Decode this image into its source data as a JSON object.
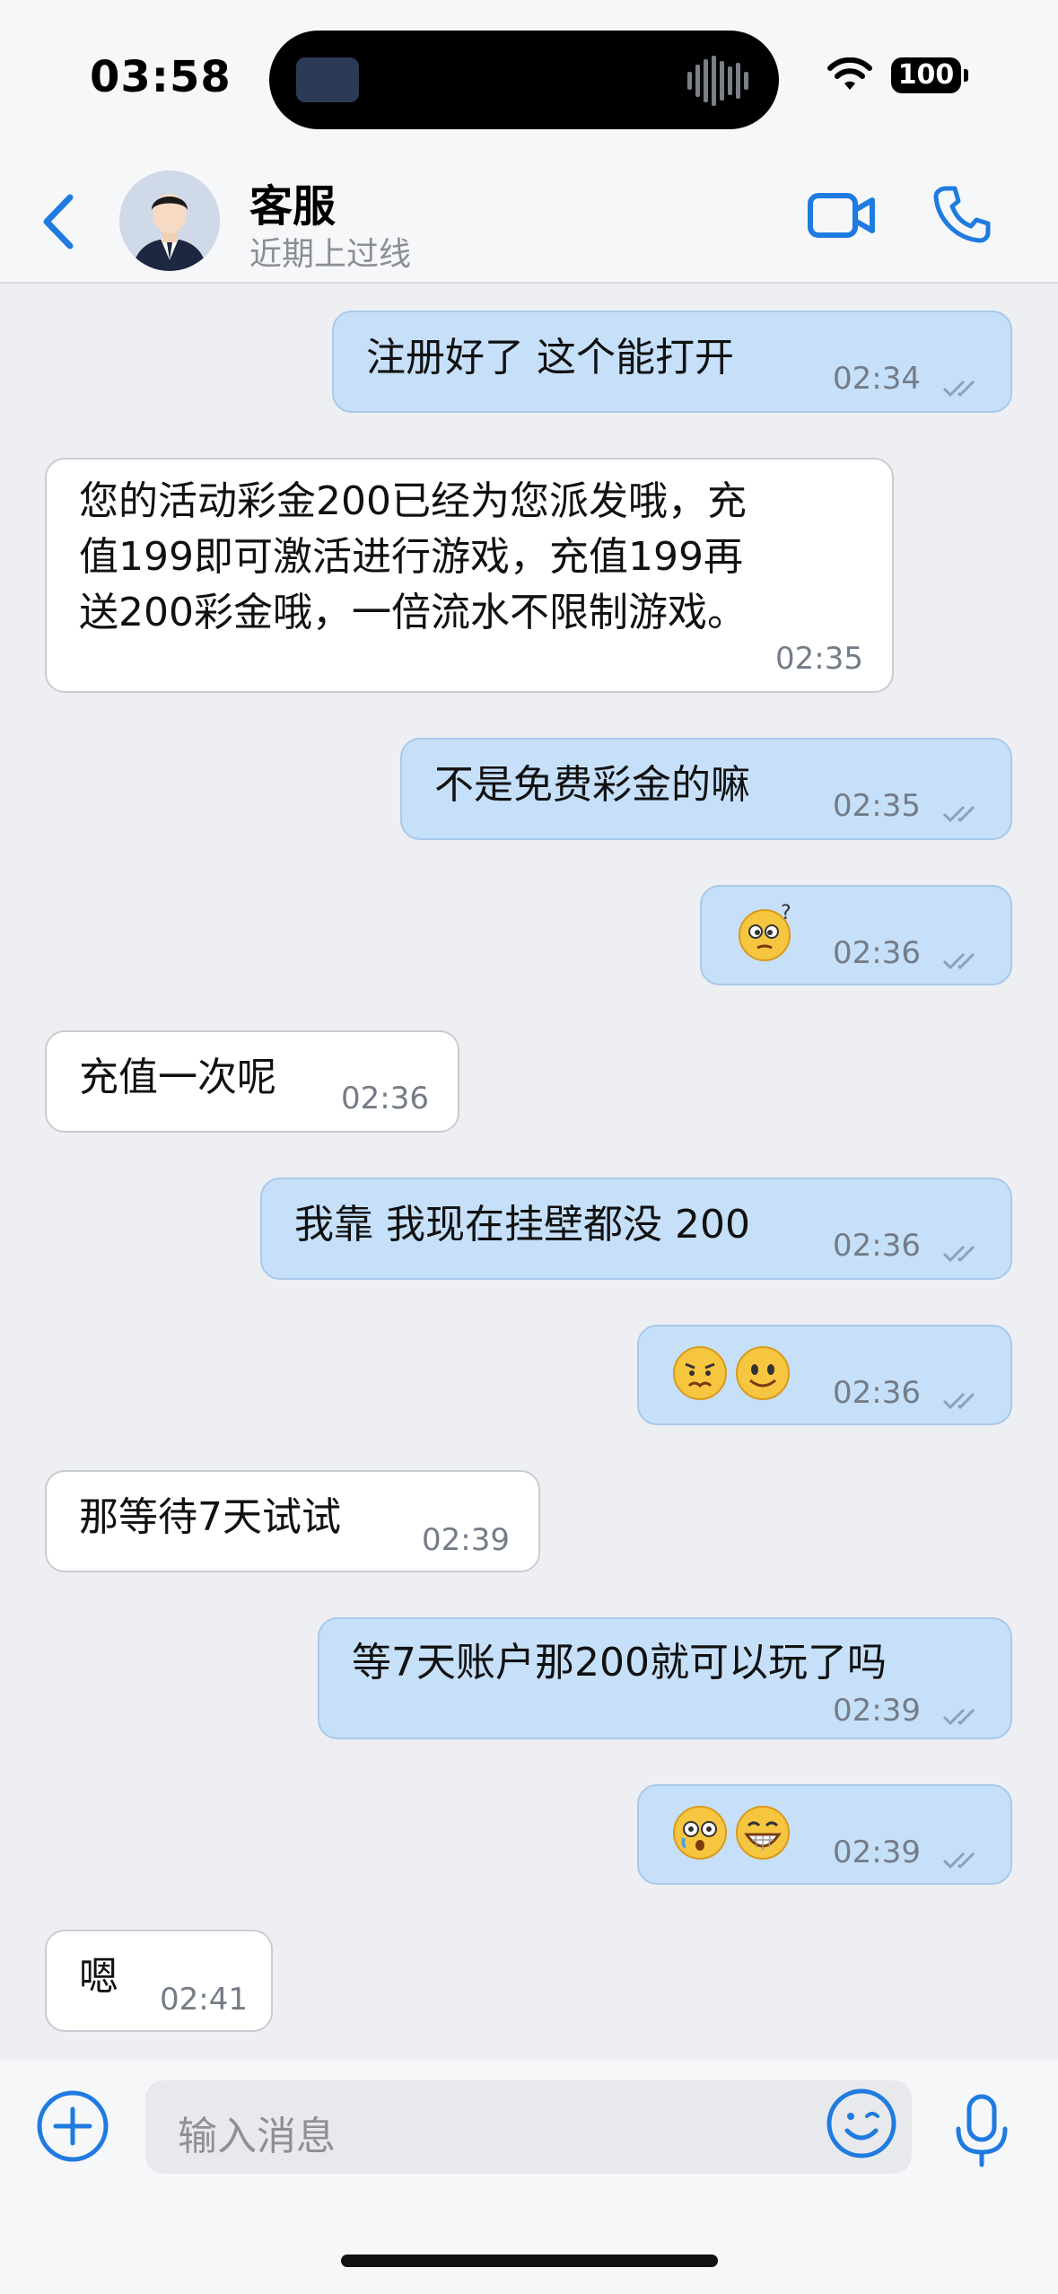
{
  "status": {
    "time": "03:58",
    "battery": "100"
  },
  "header": {
    "name": "客服",
    "presence": "近期上过线"
  },
  "messages": [
    {
      "text": "注册好了  这个能打开",
      "time": "02:34"
    },
    {
      "lines": [
        "您的活动彩金200已经为您派发哦，充",
        "值199即可激活进行游戏，充值199再",
        "送200彩金哦，一倍流水不限制游戏。"
      ],
      "time": "02:35"
    },
    {
      "text": "不是免费彩金的嘛",
      "time": "02:35"
    },
    {
      "text": "",
      "time": "02:36"
    },
    {
      "text": "充值一次呢",
      "time": "02:36"
    },
    {
      "text": "我靠 我现在挂壁都没 200",
      "time": "02:36"
    },
    {
      "text": "",
      "time": "02:36"
    },
    {
      "text": "那等待7天试试",
      "time": "02:39"
    },
    {
      "text": "等7天账户那200就可以玩了吗",
      "time": "02:39"
    },
    {
      "text": "",
      "time": "02:39"
    },
    {
      "text": "嗯",
      "time": "02:41"
    }
  ],
  "composer": {
    "placeholder": "输入消息"
  },
  "icons": {
    "back": "chevron-left-icon",
    "video": "video-camera-icon",
    "call": "phone-icon",
    "attach": "plus-circle-icon",
    "emoji": "smile-icon",
    "mic": "microphone-icon"
  },
  "colors": {
    "accent": "#1f7be0",
    "outgoing": "#c6e0f9",
    "incoming": "#ffffff"
  }
}
